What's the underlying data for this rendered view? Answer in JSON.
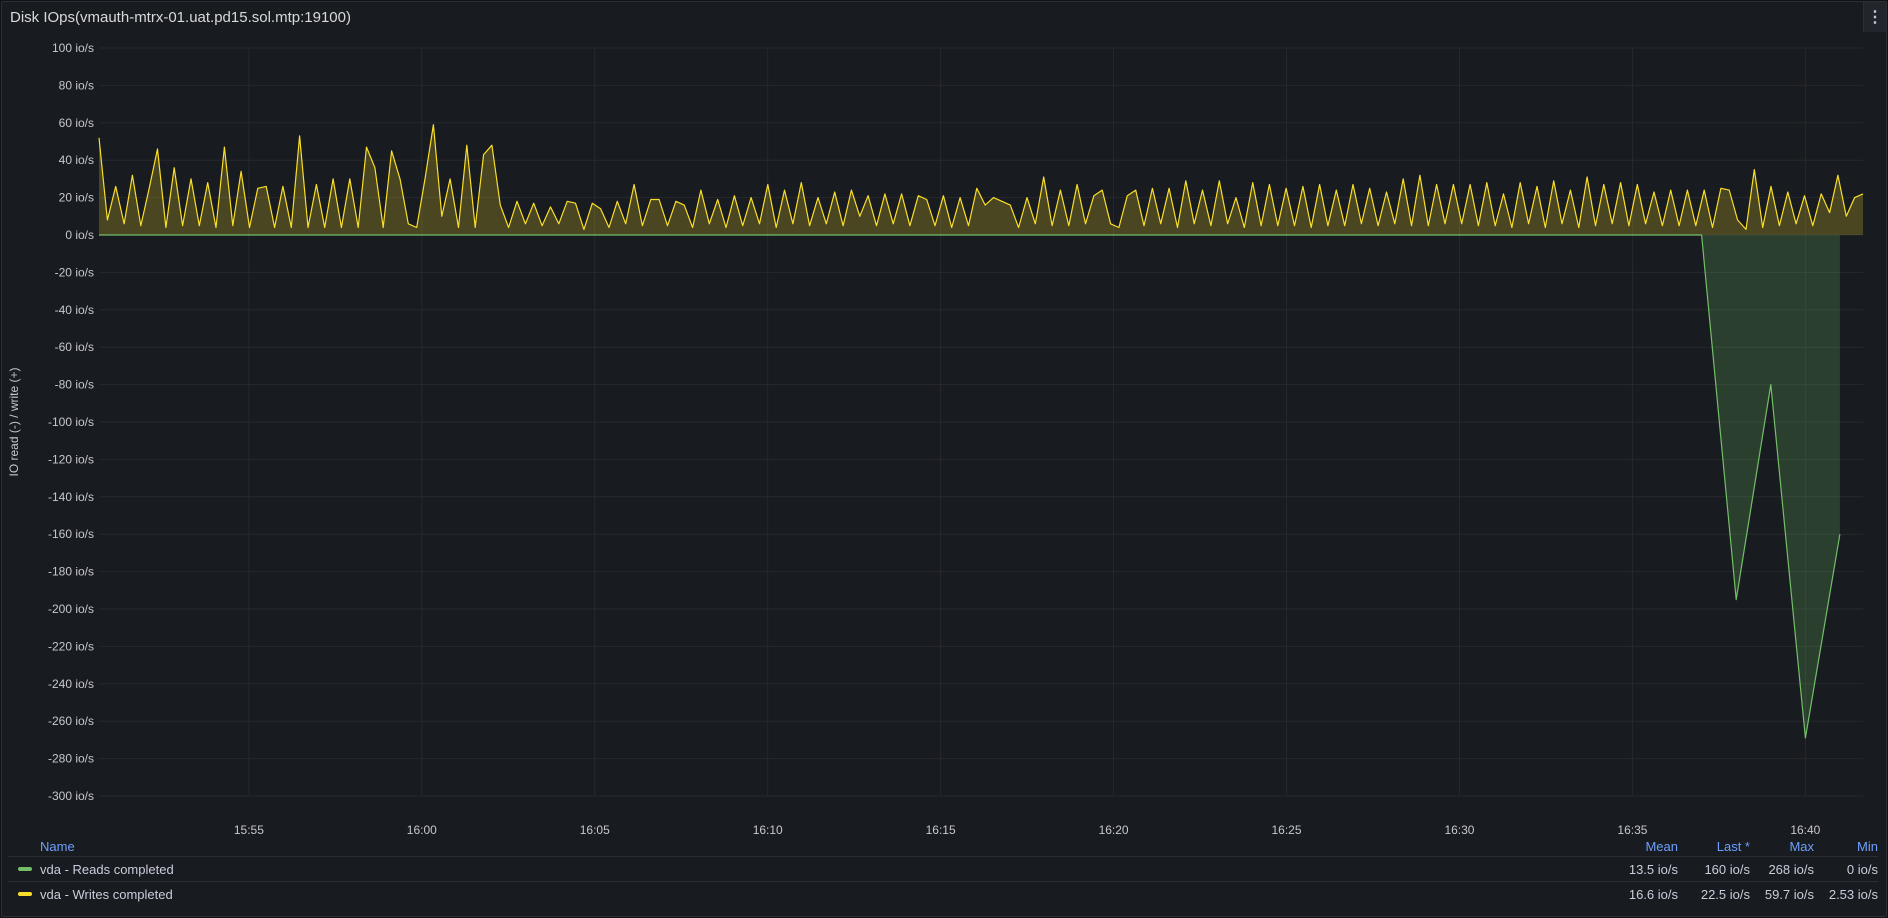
{
  "panel": {
    "title": "Disk IOps(vmauth-mtrx-01.uat.pd15.sol.mtp:19100)",
    "menu_icon": "kebab-menu-icon"
  },
  "legend": {
    "headers": {
      "name": "Name",
      "mean": "Mean",
      "last": "Last *",
      "max": "Max",
      "min": "Min"
    },
    "rows": [
      {
        "name": "vda - Reads completed",
        "color": "#73bf69",
        "mean": "13.5 io/s",
        "last": "160 io/s",
        "max": "268 io/s",
        "min": "0 io/s"
      },
      {
        "name": "vda - Writes completed",
        "color": "#fade2a",
        "mean": "16.6 io/s",
        "last": "22.5 io/s",
        "max": "59.7 io/s",
        "min": "2.53 io/s"
      }
    ]
  },
  "chart_data": {
    "type": "area",
    "ylabel": "IO read (-) / write (+)",
    "unit": "io/s",
    "ylim": [
      -300,
      100
    ],
    "yticks": [
      100,
      80,
      60,
      40,
      20,
      0,
      -20,
      -40,
      -60,
      -80,
      -100,
      -120,
      -140,
      -160,
      -180,
      -200,
      -220,
      -240,
      -260,
      -280,
      -300
    ],
    "xlim": [
      "15:50:40",
      "16:41:40"
    ],
    "xticks": [
      "15:55",
      "16:00",
      "16:05",
      "16:10",
      "16:15",
      "16:20",
      "16:25",
      "16:30",
      "16:35",
      "16:40"
    ],
    "grid": true,
    "legend_position": "bottom",
    "series": [
      {
        "name": "vda - Reads completed",
        "color": "#73bf69",
        "points": [
          [
            "15:50:40",
            0
          ],
          [
            "16:37:00",
            0
          ],
          [
            "16:38:00",
            -195
          ],
          [
            "16:39:00",
            -80
          ],
          [
            "16:40:00",
            -269
          ],
          [
            "16:41:00",
            -160
          ]
        ]
      },
      {
        "name": "vda - Writes completed",
        "color": "#fade2a",
        "values": [
          52,
          8,
          26,
          6,
          32,
          5,
          25,
          46,
          4,
          36,
          5,
          30,
          5,
          28,
          4,
          47,
          5,
          34,
          4,
          25,
          26,
          4,
          26,
          4,
          53,
          4,
          27,
          4,
          30,
          4,
          30,
          4,
          47,
          36,
          4,
          45,
          30,
          6,
          4,
          30,
          59,
          10,
          30,
          4,
          48,
          4,
          43,
          48,
          16,
          4,
          18,
          6,
          17,
          5,
          15,
          6,
          18,
          17,
          3,
          17,
          14,
          4,
          18,
          6,
          27,
          5,
          19,
          19,
          5,
          18,
          16,
          4,
          24,
          6,
          19,
          4,
          21,
          5,
          20,
          6,
          27,
          4,
          24,
          6,
          28,
          5,
          20,
          6,
          23,
          5,
          24,
          10,
          21,
          5,
          22,
          6,
          22,
          5,
          21,
          19,
          5,
          21,
          4,
          20,
          5,
          25,
          16,
          20,
          18,
          16,
          4,
          20,
          6,
          31,
          5,
          24,
          5,
          27,
          6,
          21,
          24,
          6,
          4,
          21,
          24,
          5,
          25,
          6,
          25,
          4,
          29,
          6,
          24,
          5,
          29,
          6,
          20,
          4,
          28,
          5,
          27,
          5,
          25,
          5,
          26,
          4,
          27,
          5,
          24,
          5,
          27,
          6,
          25,
          5,
          23,
          6,
          30,
          5,
          32,
          5,
          27,
          6,
          27,
          6,
          27,
          5,
          28,
          5,
          22,
          4,
          28,
          6,
          26,
          4,
          29,
          6,
          24,
          4,
          31,
          5,
          27,
          6,
          28,
          5,
          27,
          6,
          23,
          5,
          24,
          5,
          24,
          5,
          24,
          4,
          25,
          24,
          8,
          3,
          35,
          4,
          26,
          5,
          23,
          6,
          21,
          5,
          22,
          12,
          32,
          10,
          20,
          22
        ]
      }
    ]
  }
}
